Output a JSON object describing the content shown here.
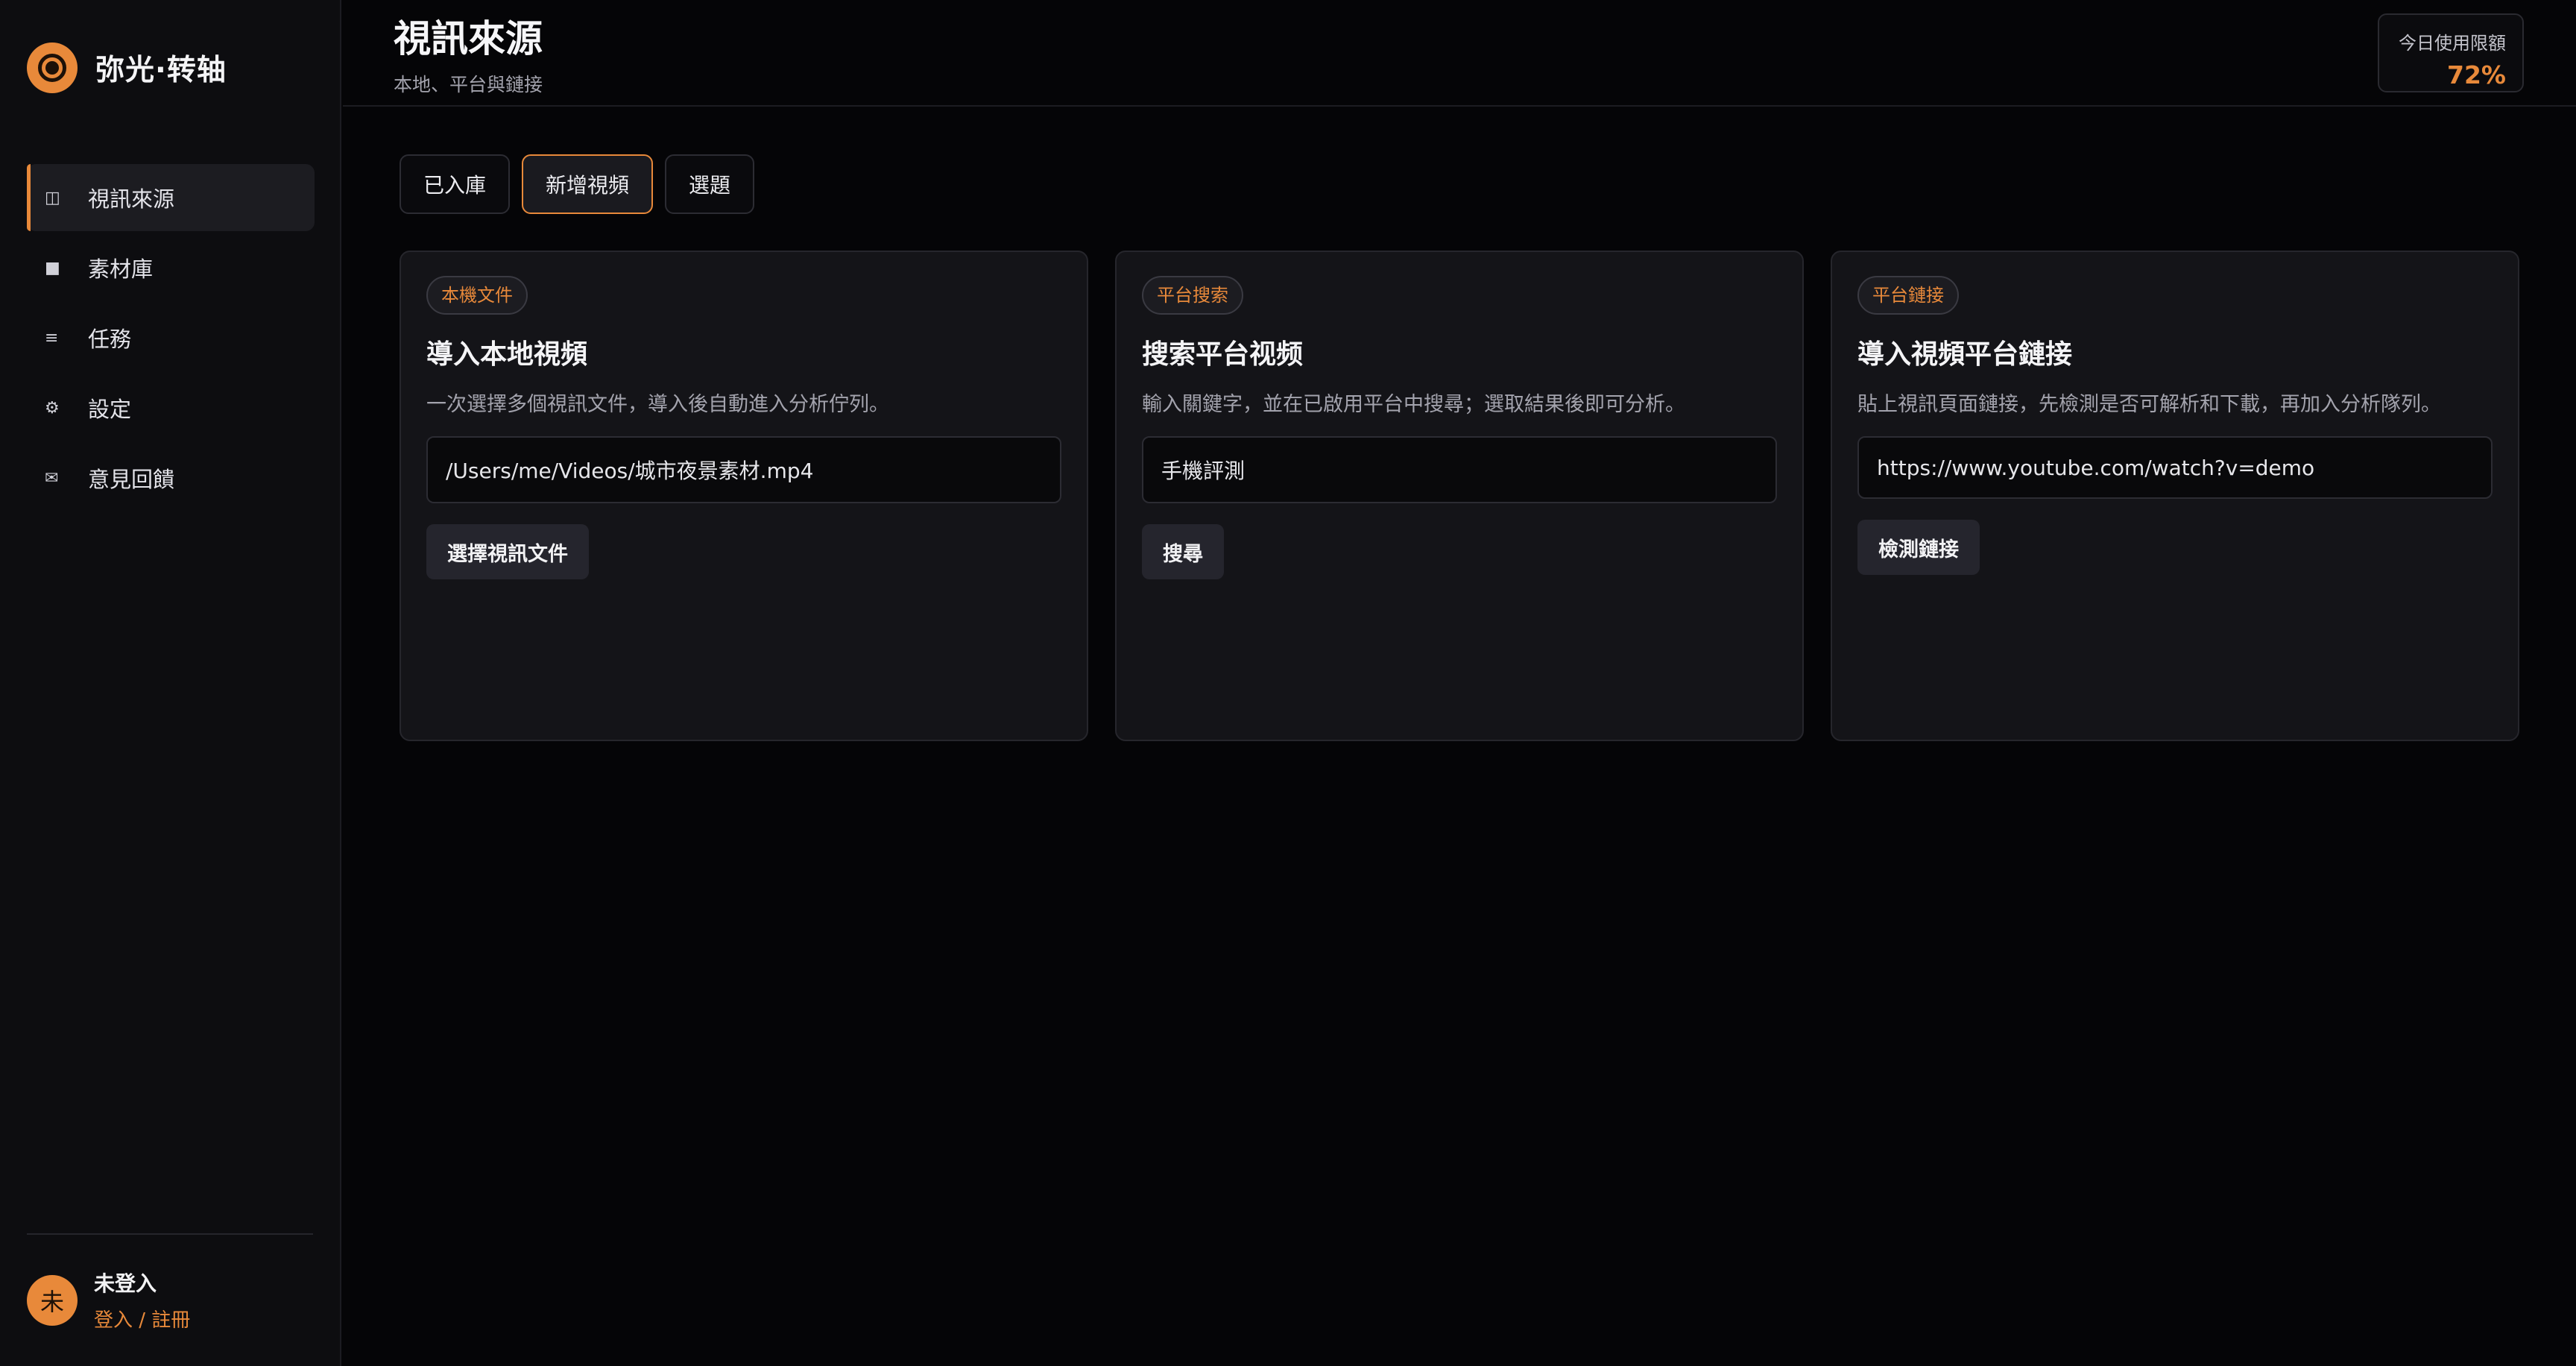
{
  "app": {
    "name": "弥光·转轴",
    "logo_icon": "aperture-icon"
  },
  "sidebar": {
    "items": [
      {
        "icon": "columns-icon",
        "glyph": "◫",
        "label": "視訊來源",
        "active": true
      },
      {
        "icon": "library-icon",
        "glyph": "■",
        "label": "素材庫",
        "active": false
      },
      {
        "icon": "list-icon",
        "glyph": "≡",
        "label": "任務",
        "active": false
      },
      {
        "icon": "gear-icon",
        "glyph": "⚙",
        "label": "設定",
        "active": false
      },
      {
        "icon": "mail-icon",
        "glyph": "✉",
        "label": "意見回饋",
        "active": false
      }
    ]
  },
  "user": {
    "avatar_text": "未",
    "name": "未登入",
    "auth_link": "登入 / 註冊"
  },
  "header": {
    "title": "視訊來源",
    "subtitle": "本地、平台與鏈接"
  },
  "quota": {
    "label": "今日使用限額",
    "value": "72%"
  },
  "tabs": [
    {
      "label": "已入庫",
      "active": false
    },
    {
      "label": "新增視頻",
      "active": true
    },
    {
      "label": "選題",
      "active": false
    }
  ],
  "cards": [
    {
      "badge": "本機文件",
      "title": "導入本地視頻",
      "description": "一次選擇多個視訊文件，導入後自動進入分析佇列。",
      "input_value": "/Users/me/Videos/城市夜景素材.mp4",
      "button": "選擇視訊文件"
    },
    {
      "badge": "平台搜索",
      "title": "搜索平台视频",
      "description": "輸入關鍵字，並在已啟用平台中搜尋；選取結果後即可分析。",
      "input_value": "手機評測",
      "button": "搜尋"
    },
    {
      "badge": "平台鏈接",
      "title": "導入視頻平台鏈接",
      "description": "貼上視訊頁面鏈接，先檢測是否可解析和下載，再加入分析隊列。",
      "input_value": "https://www.youtube.com/watch?v=demo",
      "button": "檢測鏈接"
    }
  ],
  "colors": {
    "accent": "#e8893a",
    "background": "#050507",
    "sidebar": "#0d0d10",
    "card": "#141418"
  }
}
